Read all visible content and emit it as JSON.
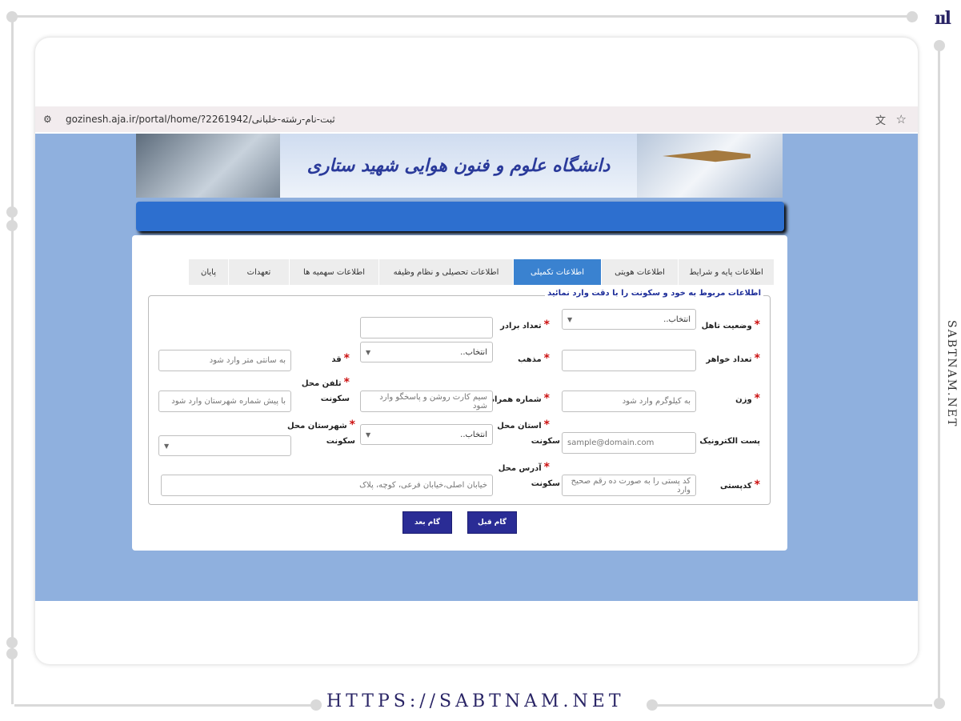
{
  "brand": {
    "logo": "ııl",
    "side_text": "SABTNAM.NET",
    "footer_url": "HTTPS://SABTNAM.NET"
  },
  "browser": {
    "url": "gozinesh.aja.ir/portal/home/?2261942/ثبت-نام-رشته-خلبانی"
  },
  "banner": {
    "title": "دانشگاه علوم و فنون هوایی شهید ستاری"
  },
  "steps": [
    {
      "label": "اطلاعات پایه و شرایط",
      "active": false
    },
    {
      "label": "اطلاعات هویتی",
      "active": false
    },
    {
      "label": "اطلاعات تکمیلی",
      "active": true
    },
    {
      "label": "اطلاعات تحصیلی و نظام وظیفه",
      "active": false
    },
    {
      "label": "اطلاعات سهمیه ها",
      "active": false
    },
    {
      "label": "تعهدات",
      "active": false
    },
    {
      "label": "پایان",
      "active": false
    }
  ],
  "form": {
    "legend": "اطلاعات مربوط به خود و سکونت را با دقت وارد نمائید",
    "marital_label": "وضعیت تاهل",
    "marital_value": "انتخاب..",
    "brothers_label": "تعداد برادر",
    "sisters_label": "تعداد خواهر",
    "religion_label": "مذهب",
    "religion_value": "انتخاب..",
    "height_label": "قد",
    "height_placeholder": "به سانتی متر وارد شود",
    "weight_label": "وزن",
    "weight_placeholder": "به کیلوگرم وارد شود",
    "mobile_label": "شماره همراه",
    "mobile_placeholder": "سیم کارت روشن و پاسخگو وارد شود",
    "phone_label_1": "تلفن محل",
    "phone_label_2": "سکونت",
    "phone_placeholder": "با پیش شماره شهرستان وارد شود",
    "email_label": "پست الکترونیک",
    "email_placeholder": "sample@domain.com",
    "province_label_1": "استان محل",
    "province_label_2": "سکونت",
    "province_value": "انتخاب..",
    "city_label_1": "شهرستان محل",
    "city_label_2": "سکونت",
    "postal_label": "کدپستی",
    "postal_placeholder": "کد پستی را به صورت ده رقم صحیح وارد",
    "address_label_1": "آدرس محل",
    "address_label_2": "سکونت",
    "address_placeholder": "خیابان اصلی،خیابان فرعی، کوچه، پلاک"
  },
  "buttons": {
    "prev": "گام قبل",
    "next": "گام بعد"
  },
  "colors": {
    "viewport_bg": "#8fb0de",
    "active_step": "#3a82d0",
    "button": "#2a2c95",
    "required": "#cc1111"
  }
}
